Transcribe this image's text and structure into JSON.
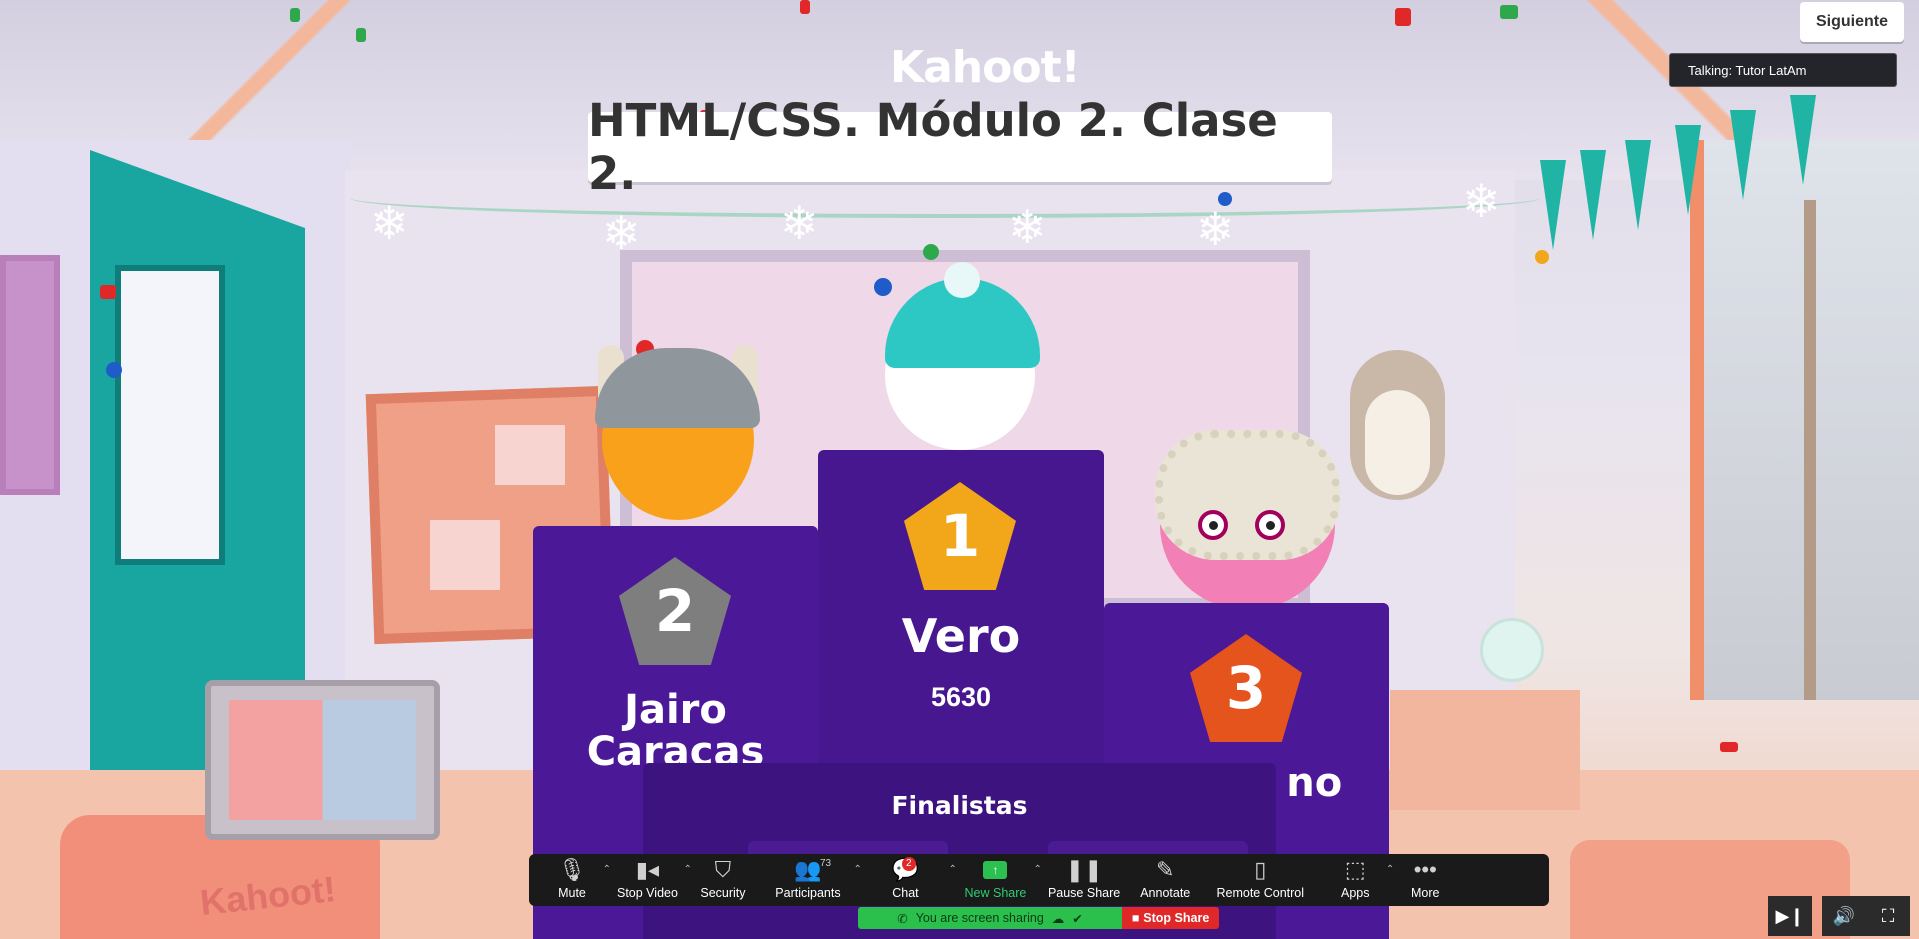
{
  "top_right": {
    "next_button": "Siguiente",
    "talking_label": "Talking: Tutor LatAm"
  },
  "logo": "Kahoot!",
  "title": "HTML/CSS. Módulo 2. Clase 2.",
  "podium": {
    "first": {
      "rank": "1",
      "name": "Vero",
      "score": "5630"
    },
    "second": {
      "rank": "2",
      "name": "Jairo Caracas"
    },
    "third": {
      "rank": "3",
      "name": "id no H"
    }
  },
  "finalistas_label": "Finalistas",
  "laptop_logo": "Kahoot!",
  "toolbar": {
    "mute": "Mute",
    "stop_video": "Stop Video",
    "security": "Security",
    "participants": "Participants",
    "participants_count": "73",
    "chat": "Chat",
    "chat_badge": "2",
    "new_share": "New Share",
    "pause_share": "Pause Share",
    "annotate": "Annotate",
    "remote_control": "Remote Control",
    "apps": "Apps",
    "more": "More"
  },
  "share_status": {
    "sharing_text": "You are screen sharing",
    "stop_share": "Stop Share"
  },
  "colors": {
    "podium_purple": "#46178f",
    "gold": "#f2a71b",
    "silver": "#7e7e7e",
    "bronze": "#e5541d",
    "share_green": "#2bbf4c",
    "stop_red": "#e02828"
  }
}
